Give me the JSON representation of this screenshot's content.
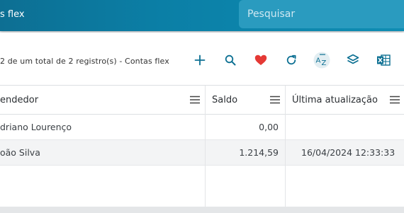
{
  "header": {
    "title": "s flex",
    "search": {
      "placeholder": "Pesquisar",
      "value": ""
    }
  },
  "toolbar": {
    "record_count": "2 de um total de 2 registro(s) - Contas flex",
    "icons": [
      "plus-icon",
      "search-icon",
      "heart-icon",
      "refresh-icon",
      "sort-az-icon",
      "layers-icon",
      "excel-icon"
    ],
    "accent_color": "#0b7fa6",
    "heart_color": "#e53935"
  },
  "grid": {
    "columns": [
      "endedor",
      "Saldo",
      "Última atualização"
    ],
    "rows": [
      {
        "vendedor": "driano  Lourenço",
        "saldo": "0,00",
        "atualizacao": ""
      },
      {
        "vendedor": "oão  Silva",
        "saldo": "1.214,59",
        "atualizacao": "16/04/2024 12:33:33"
      }
    ]
  }
}
